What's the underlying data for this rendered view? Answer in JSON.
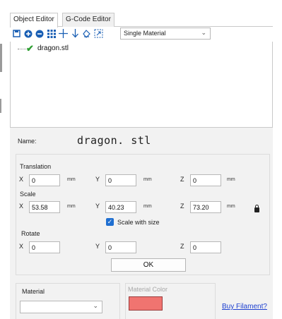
{
  "tabs": [
    {
      "label": "Object Editor",
      "active": true
    },
    {
      "label": "G-Code Editor",
      "active": false
    }
  ],
  "toolbar": {
    "icons": [
      "save-icon",
      "add-icon",
      "remove-icon",
      "grid-icon",
      "move-icon",
      "drop-icon",
      "paint-icon",
      "scale-fit-icon"
    ],
    "material_mode": "Single Material"
  },
  "tree": {
    "items": [
      {
        "label": "dragon.stl",
        "checked": true
      }
    ]
  },
  "properties": {
    "name_label": "Name:",
    "name_value": "dragon. stl",
    "translation": {
      "label": "Translation",
      "x_axis": "X",
      "y_axis": "Y",
      "z_axis": "Z",
      "x": "0",
      "y": "0",
      "z": "0",
      "unit": "mm"
    },
    "scale": {
      "label": "Scale",
      "x_axis": "X",
      "y_axis": "Y",
      "z_axis": "Z",
      "x": "53.58",
      "y": "40.23",
      "z": "73.20",
      "unit": "mm",
      "scale_with_size_label": "Scale with size",
      "scale_with_size_checked": true
    },
    "rotate": {
      "label": "Rotate",
      "x_axis": "X",
      "y_axis": "Y",
      "z_axis": "Z",
      "x": "0",
      "y": "0",
      "z": "0"
    },
    "ok_label": "OK"
  },
  "material": {
    "label": "Material",
    "selected": "",
    "color_label": "Material Color",
    "color": "#f07470",
    "buy_link": "Buy Filament?"
  }
}
